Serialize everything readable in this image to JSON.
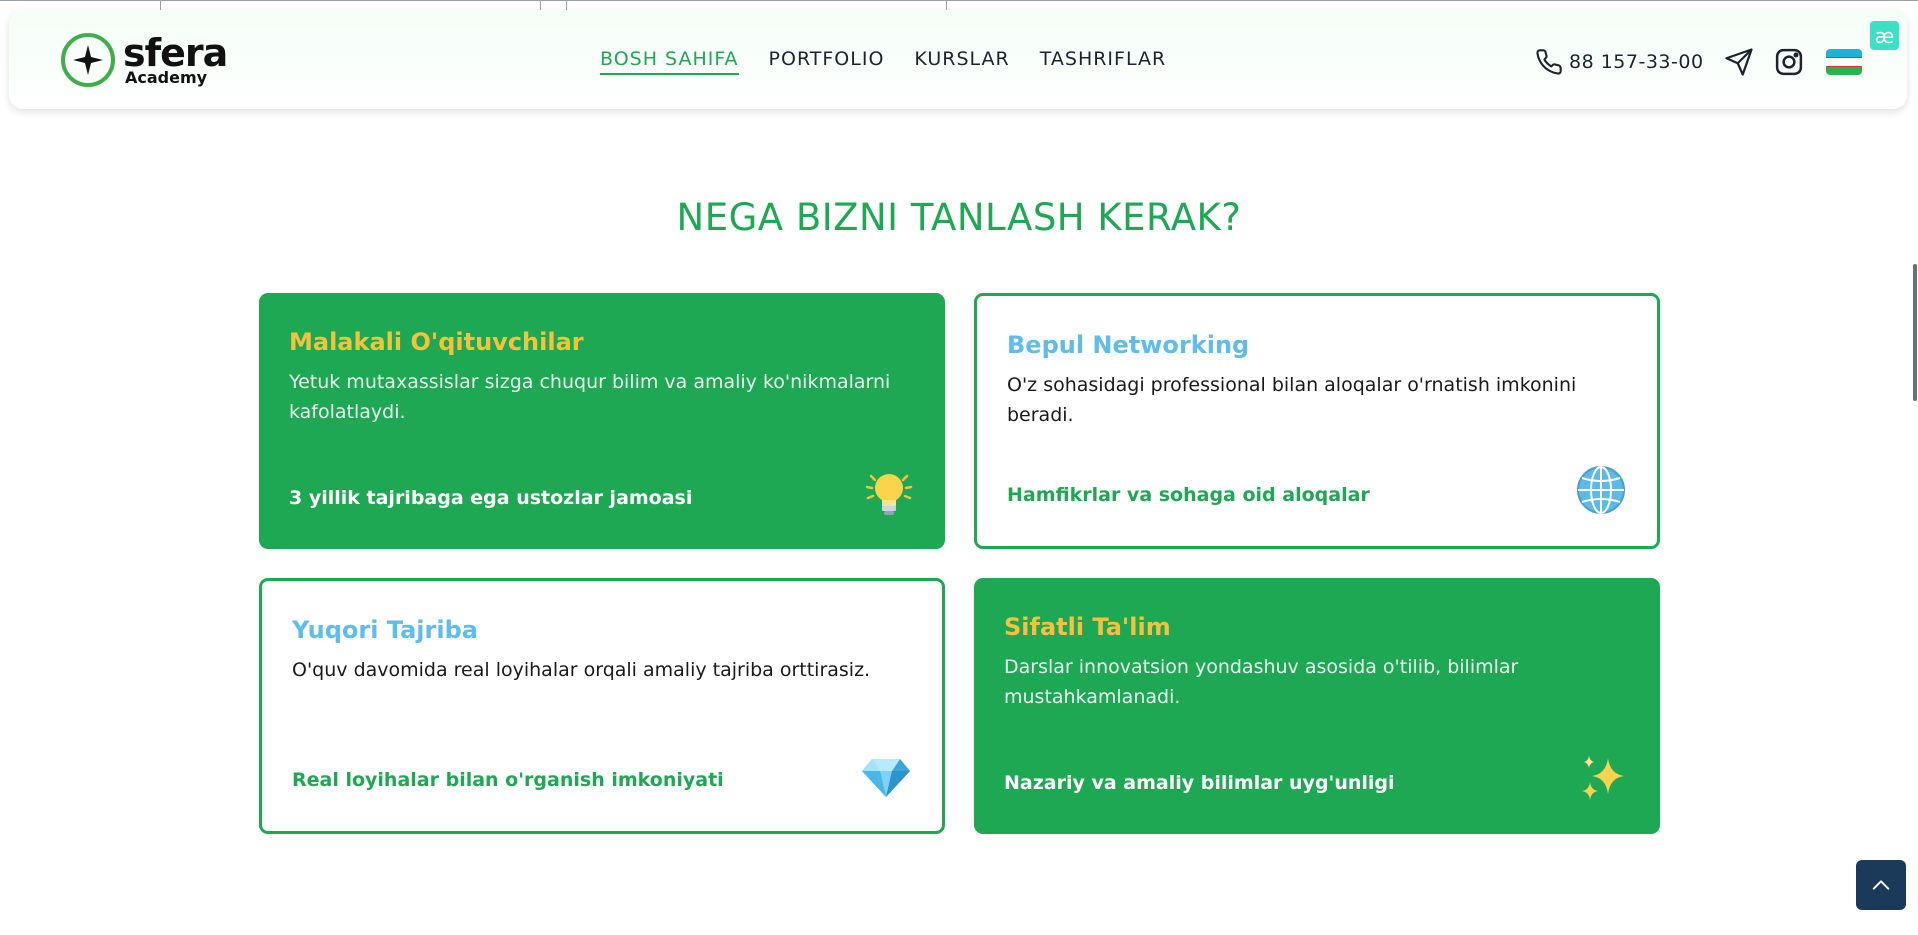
{
  "header": {
    "logo_word": "sfera",
    "logo_sub": "Academy",
    "nav": [
      {
        "label": "BOSH SAHIFA",
        "active": true
      },
      {
        "label": "PORTFOLIO",
        "active": false
      },
      {
        "label": "KURSLAR",
        "active": false
      },
      {
        "label": "TASHRIFLAR",
        "active": false
      }
    ],
    "phone": "88 157-33-00",
    "badge": "æ"
  },
  "section": {
    "title": "NEGA BIZNI TANLASH KERAK?"
  },
  "cards": [
    {
      "title": "Malakali O'qituvchilar",
      "desc": "Yetuk mutaxassislar sizga chuqur bilim va amaliy ko'nikmalarni kafolatlaydi.",
      "foot": "3 yillik tajribaga ega ustozlar jamoasi",
      "icon": "lightbulb-icon",
      "style": "filled"
    },
    {
      "title": "Bepul Networking",
      "desc": "O'z sohasidagi professional bilan aloqalar o'rnatish imkonini beradi.",
      "foot": "Hamfikrlar va sohaga oid aloqalar",
      "icon": "globe-icon",
      "style": "outline"
    },
    {
      "title": "Yuqori Tajriba",
      "desc": "O'quv davomida real loyihalar orqali amaliy tajriba orttirasiz.",
      "foot": "Real loyihalar bilan o'rganish imkoniyati",
      "icon": "gem-icon",
      "style": "outline"
    },
    {
      "title": "Sifatli Ta'lim",
      "desc": "Darslar innovatsion yondashuv asosida o'tilib, bilimlar mustahkamlanadi.",
      "foot": "Nazariy va amaliy bilimlar uyg'unligi",
      "icon": "sparkles-icon",
      "style": "filled"
    }
  ],
  "colors": {
    "primary": "#1ea853",
    "accent_yellow": "#f7c23b",
    "accent_blue": "#5fbde9",
    "scroll_top_bg": "#1b3a5a"
  }
}
